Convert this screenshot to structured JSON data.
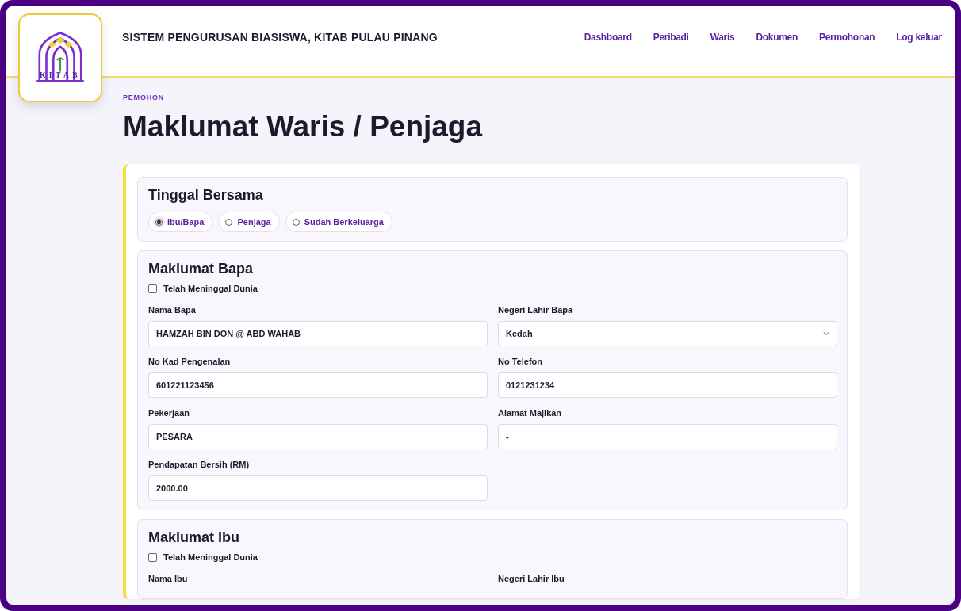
{
  "header": {
    "logo_text": "KITAB",
    "title": "SISTEM PENGURUSAN BIASISWA, KITAB PULAU PINANG",
    "nav": [
      "Dashboard",
      "Peribadi",
      "Waris",
      "Dokumen",
      "Permohonan",
      "Log keluar"
    ]
  },
  "page": {
    "eyebrow": "PEMOHON",
    "heading": "Maklumat Waris / Penjaga"
  },
  "sections": [
    {
      "kind": "radio",
      "title": "Tinggal Bersama",
      "options": [
        {
          "label": "Ibu/Bapa",
          "selected": true
        },
        {
          "label": "Penjaga",
          "selected": false
        },
        {
          "label": "Sudah Berkeluarga",
          "selected": false
        }
      ]
    },
    {
      "kind": "person",
      "title": "Maklumat Bapa",
      "deceased": {
        "label": "Telah Meninggal Dunia",
        "checked": false
      },
      "fields": [
        {
          "kind": "text",
          "label": "Nama Bapa",
          "value": "HAMZAH BIN DON @ ABD WAHAB"
        },
        {
          "kind": "select",
          "label": "Negeri Lahir Bapa",
          "value": "Kedah"
        },
        {
          "kind": "text",
          "label": "No Kad Pengenalan",
          "value": "601221123456"
        },
        {
          "kind": "text",
          "label": "No Telefon",
          "value": "0121231234"
        },
        {
          "kind": "text",
          "label": "Pekerjaan",
          "value": "PESARA"
        },
        {
          "kind": "text",
          "label": "Alamat Majikan",
          "value": "-"
        },
        {
          "kind": "text",
          "label": "Pendapatan Bersih (RM)",
          "value": "2000.00"
        }
      ]
    },
    {
      "kind": "person",
      "title": "Maklumat Ibu",
      "deceased": {
        "label": "Telah Meninggal Dunia",
        "checked": false
      },
      "fields": [
        {
          "kind": "label",
          "label": "Nama Ibu"
        },
        {
          "kind": "label",
          "label": "Negeri Lahir Ibu"
        }
      ]
    }
  ]
}
